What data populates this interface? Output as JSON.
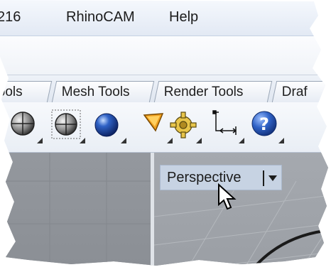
{
  "menubar": {
    "items": [
      {
        "label": "216"
      },
      {
        "label": "RhinoCAM"
      },
      {
        "label": "Help"
      }
    ]
  },
  "tabs": [
    {
      "label": "ools"
    },
    {
      "label": "Mesh Tools"
    },
    {
      "label": "Render Tools"
    },
    {
      "label": "Draf"
    }
  ],
  "toolbar": {
    "tools": [
      {
        "icon": "gray-sphere-icon"
      },
      {
        "icon": "wireframe-sphere-icon"
      },
      {
        "icon": "blue-sphere-icon"
      },
      {
        "icon": "spotlight-icon"
      },
      {
        "icon": "gear-settings-icon"
      },
      {
        "icon": "dimension-icon"
      },
      {
        "icon": "help-icon"
      }
    ]
  },
  "viewport": {
    "title": "Perspective"
  },
  "colors": {
    "menubar": "#e8eef7",
    "viewport_gray": "#8f9399",
    "viewport_title_bg": "#c7d3e3",
    "help_blue": "#2f62c6"
  }
}
